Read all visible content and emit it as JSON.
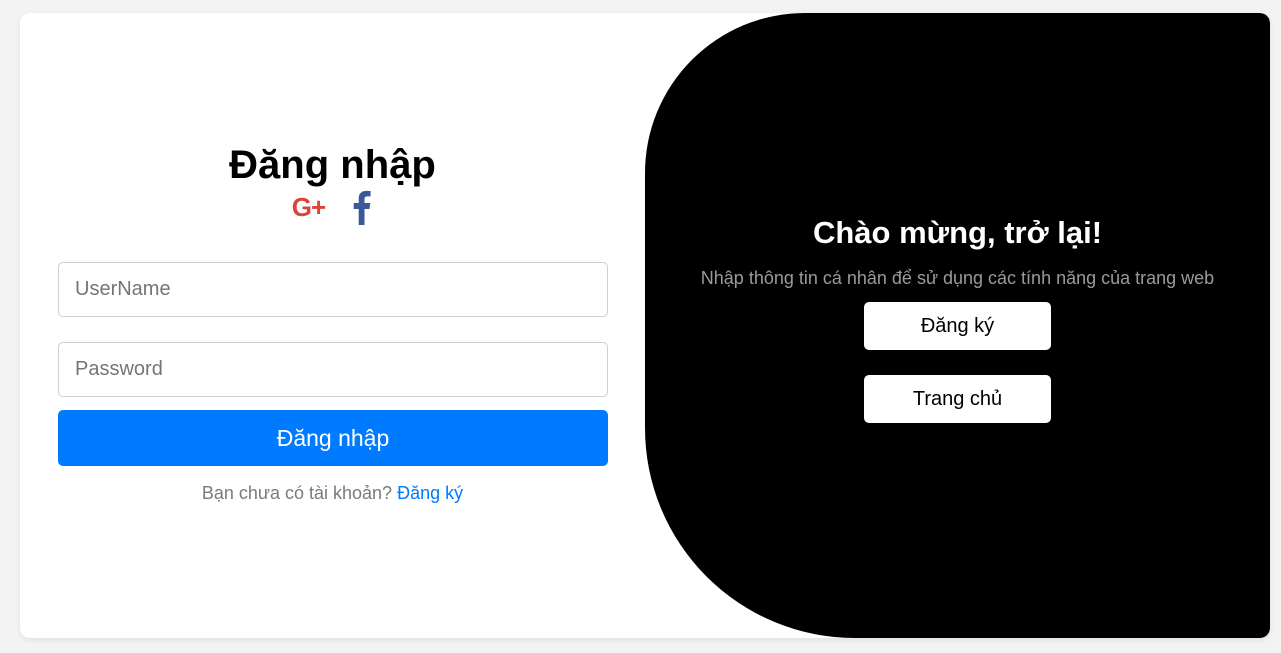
{
  "login": {
    "title": "Đăng nhập",
    "social": {
      "google_label": "G+",
      "google_color": "#db4437",
      "facebook_color": "#3b5998"
    },
    "username_placeholder": "UserName",
    "password_placeholder": "Password",
    "submit_label": "Đăng nhập",
    "signup_prompt": "Bạn chưa có tài khoản?",
    "signup_link": "Đăng ký"
  },
  "welcome": {
    "title": "Chào mừng, trở lại!",
    "subtitle": "Nhập thông tin cá nhân để sử dụng các tính năng của trang web",
    "register_label": "Đăng ký",
    "home_label": "Trang chủ"
  },
  "colors": {
    "accent": "#007bff",
    "panel_bg": "#000000"
  }
}
